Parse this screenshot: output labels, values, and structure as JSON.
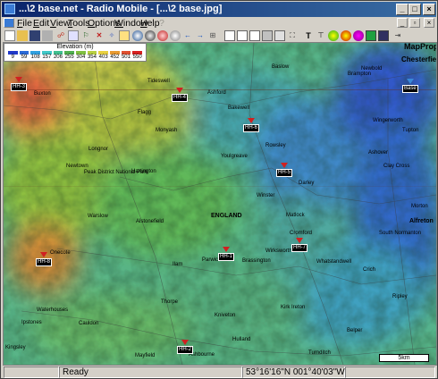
{
  "window": {
    "title": "...\\2 base.net - Radio Mobile - [...\\2 base.jpg]",
    "min_glyph": "_",
    "max_glyph": "□",
    "close_glyph": "×"
  },
  "menu": {
    "items": [
      {
        "label": "File",
        "underline": "F"
      },
      {
        "label": "Edit",
        "underline": "E"
      },
      {
        "label": "View",
        "underline": "V"
      },
      {
        "label": "Tools",
        "underline": "T"
      },
      {
        "label": "Options",
        "underline": "O"
      },
      {
        "label": "Window",
        "underline": "W"
      },
      {
        "label": "Help",
        "underline": "H"
      }
    ],
    "greyed": "?"
  },
  "toolbar": {
    "icons": [
      "new-icon",
      "open-icon",
      "save-icon",
      "print-icon",
      "network-icon",
      "properties-icon",
      "world-icon",
      "map-extract-icon",
      "radio-link-icon",
      "visual-coverage-icon",
      "antenna-icon",
      "shift-left-icon",
      "shift-right-icon",
      "zoom-icon",
      "copy-icon",
      "paste-icon",
      "picture-icon",
      "overlay-icon",
      "merge-icon",
      "fit-icon",
      "text-icon",
      "pointer-icon",
      "radar-icon",
      "color-icon",
      "cover-icon",
      "route-icon",
      "globe-icon",
      "mail-icon",
      "exit-icon"
    ]
  },
  "elevation_legend": {
    "title": "Elevation (m)",
    "ticks": [
      "9",
      "59",
      "108",
      "157",
      "206",
      "255",
      "304",
      "354",
      "403",
      "452",
      "501",
      "550"
    ],
    "colors": [
      "#2038c8",
      "#2a6ad8",
      "#30a0e0",
      "#40c8c8",
      "#40c090",
      "#50b050",
      "#80c040",
      "#b8d040",
      "#e8d040",
      "#e89a30",
      "#e05030",
      "#d82020"
    ]
  },
  "places": {
    "mapprop": "MapProp",
    "chesterfield": "Chesterfield",
    "tideswell": "Tideswell",
    "ashford": "Ashford",
    "bakewell": "Bakewell",
    "baslow": "Baslow",
    "brampton": "Brampton",
    "newbold": "Newbold",
    "buxton": "Buxton",
    "flagg": "Flagg",
    "monyash": "Monyash",
    "longnor": "Longnor",
    "newtown": "Newtown",
    "peak_park": "Peak District National Park",
    "hartington": "Hartington",
    "youlgreave": "Youlgreave",
    "rowsley": "Rowsley",
    "winster": "Winster",
    "darley": "Darley",
    "ashover": "Ashover",
    "clay_cross": "Clay Cross",
    "tupton": "Tupton",
    "wingerworth": "Wingerworth",
    "england": "ENGLAND",
    "matlock": "Matlock",
    "wirksworth": "Wirksworth",
    "cromford": "Cromford",
    "brassington": "Brassington",
    "middleton": "Middleton",
    "south_normanton": "South Normanton",
    "alfreton": "Alfreton",
    "morton": "Morton",
    "warslow": "Warslow",
    "onecote": "Onecote",
    "alstonefield": "Alstonefield",
    "parwich": "Parwich",
    "ilam": "Ilam",
    "crich": "Crich",
    "whatstandwell": "Whatstandwell",
    "waterhouses": "Waterhouses",
    "cauldon": "Cauldon",
    "thorpe": "Thorpe",
    "kniveton": "Kniveton",
    "kirk_ireton": "Kirk Ireton",
    "ashbourne": "Ashbourne",
    "hulland": "Hulland",
    "turnditch": "Turnditch",
    "mayfield": "Mayfield",
    "belper": "Belper",
    "ripley": "Ripley",
    "kingsley": "Kingsley",
    "ipstones": "Ipstones"
  },
  "stations": [
    {
      "label": "Base"
    },
    {
      "label": "HH-3"
    },
    {
      "label": "HH-4"
    },
    {
      "label": "HH-6"
    },
    {
      "label": "HH-5"
    },
    {
      "label": "HH-1"
    },
    {
      "label": "HH-2"
    },
    {
      "label": "HH-8"
    },
    {
      "label": "HH-7"
    }
  ],
  "scale_label": "5km",
  "status": {
    "ready": "Ready",
    "coords": "53°16'16\"N 001°40'03\"W"
  }
}
